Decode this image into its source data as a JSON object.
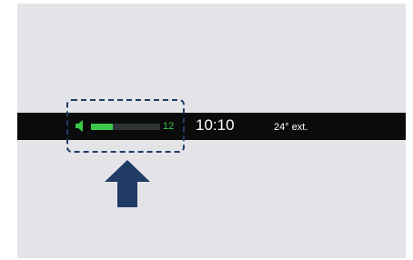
{
  "status_bar": {
    "volume": {
      "icon": "speaker-icon",
      "level": 12,
      "level_label": "12",
      "fill_fraction": 0.31,
      "fill_color": "#3cc84a",
      "track_color": "#2e3336"
    },
    "clock": "10:10",
    "temperature": "24° ext."
  },
  "annotation": {
    "highlight_color": "#1f3b66",
    "arrow_icon": "up-arrow-icon",
    "arrow_color": "#1f3b66"
  }
}
